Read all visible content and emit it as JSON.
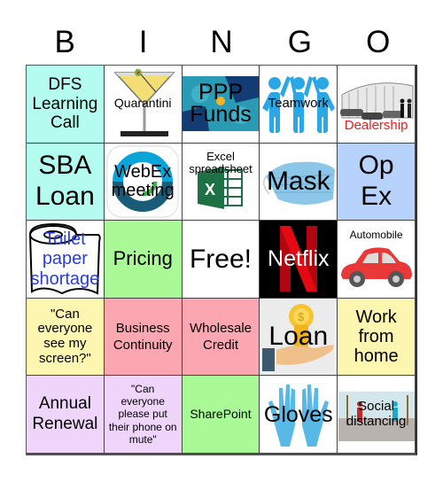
{
  "header": {
    "letters": [
      "B",
      "I",
      "N",
      "G",
      "O"
    ]
  },
  "colors": {
    "teal": "#b3fcef",
    "green": "#a9f996",
    "blue": "#b7d3fd",
    "yellow": "#fcf6b0",
    "pink": "#fba6b1",
    "lilac": "#efd5fa",
    "dealership_text": "#e8201f",
    "toilet_text": "#2a3be0",
    "netflix_red": "#e50914"
  },
  "board": {
    "cells": [
      {
        "label": "DFS Learning Call",
        "icon": "none"
      },
      {
        "label": "Quarantini",
        "icon": "martini-glass-icon"
      },
      {
        "label": "PPP Funds",
        "icon": "coin-handshake-icon"
      },
      {
        "label": "Teamwork",
        "icon": "team-people-icon"
      },
      {
        "label": "Dealership",
        "icon": "car-dealership-icon"
      },
      {
        "label": "SBA Loan",
        "icon": "none"
      },
      {
        "label": "WebEx meeting",
        "icon": "webex-logo-icon"
      },
      {
        "label": "Excel spreadsheet",
        "icon": "excel-logo-icon"
      },
      {
        "label": "Mask",
        "icon": "face-mask-icon"
      },
      {
        "label": "Op Ex",
        "icon": "none"
      },
      {
        "label": "Toilet paper shortage",
        "icon": "toilet-paper-icon"
      },
      {
        "label": "Pricing",
        "icon": "none"
      },
      {
        "label": "Free!",
        "icon": "none"
      },
      {
        "label": "Netflix",
        "icon": "netflix-logo-icon"
      },
      {
        "label": "Automobile",
        "icon": "red-car-icon"
      },
      {
        "label": "\"Can everyone see my screen?\"",
        "icon": "none"
      },
      {
        "label": "Business Continuity",
        "icon": "none"
      },
      {
        "label": "Wholesale Credit",
        "icon": "none"
      },
      {
        "label": "Loan",
        "icon": "hand-coin-icon"
      },
      {
        "label": "Work from home",
        "icon": "none"
      },
      {
        "label": "Annual Renewal",
        "icon": "none"
      },
      {
        "label": "\"Can everyone please put their phone on mute\"",
        "icon": "none"
      },
      {
        "label": "SharePoint",
        "icon": "none"
      },
      {
        "label": "Gloves",
        "icon": "gloves-icon"
      },
      {
        "label": "Social distancing",
        "icon": "social-distancing-icon"
      }
    ]
  }
}
